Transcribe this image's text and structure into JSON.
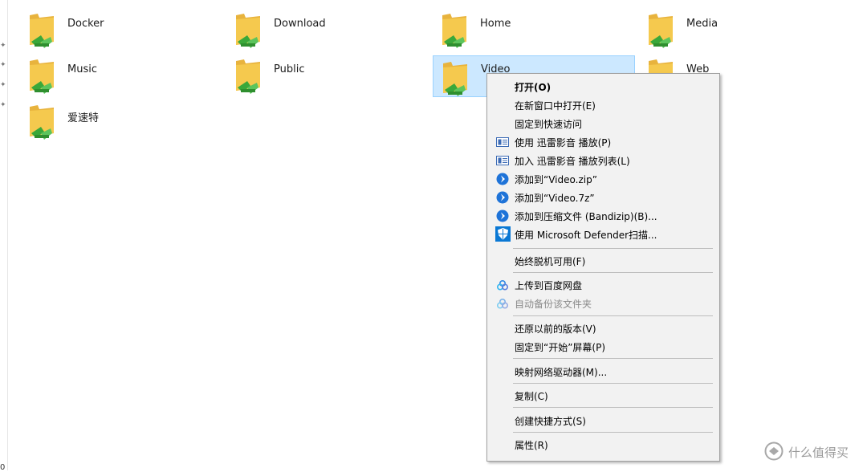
{
  "folders": [
    {
      "name": "Docker"
    },
    {
      "name": "Download"
    },
    {
      "name": "Home"
    },
    {
      "name": "Media"
    },
    {
      "name": "Music"
    },
    {
      "name": "Public"
    },
    {
      "name": "Video"
    },
    {
      "name": "Web"
    },
    {
      "name": "爱速特"
    }
  ],
  "corner_digit": "0",
  "context_menu": {
    "items": [
      {
        "label": "打开(O)",
        "style": "bold"
      },
      {
        "label": "在新窗口中打开(E)"
      },
      {
        "label": "固定到快速访问"
      },
      {
        "label": "使用 迅雷影音 播放(P)",
        "icon": "xunlei-player-icon"
      },
      {
        "label": "加入 迅雷影音 播放列表(L)",
        "icon": "xunlei-playlist-icon"
      },
      {
        "label": "添加到“Video.zip”",
        "icon": "bandizip-icon"
      },
      {
        "label": "添加到“Video.7z”",
        "icon": "bandizip-icon"
      },
      {
        "label": "添加到压缩文件 (Bandizip)(B)...",
        "icon": "bandizip-icon"
      },
      {
        "label": "使用 Microsoft Defender扫描...",
        "icon": "defender-shield-icon"
      },
      {
        "label": "始终脱机可用(F)"
      },
      {
        "label": "上传到百度网盘",
        "icon": "baidu-netdisk-icon"
      },
      {
        "label": "自动备份该文件夹",
        "icon": "baidu-netdisk-icon",
        "state": "disabled"
      },
      {
        "label": "还原以前的版本(V)"
      },
      {
        "label": "固定到“开始”屏幕(P)"
      },
      {
        "label": "映射网络驱动器(M)..."
      },
      {
        "label": "复制(C)"
      },
      {
        "label": "创建快捷方式(S)"
      },
      {
        "label": "属性(R)"
      }
    ]
  },
  "watermark": {
    "text": "什么值得买"
  },
  "colors": {
    "selection_bg": "#cce8ff",
    "selection_border": "#99d1ff",
    "menu_bg": "#f2f2f2",
    "folder_yellow": "#f5c94e",
    "network_green": "#3aa83a"
  }
}
